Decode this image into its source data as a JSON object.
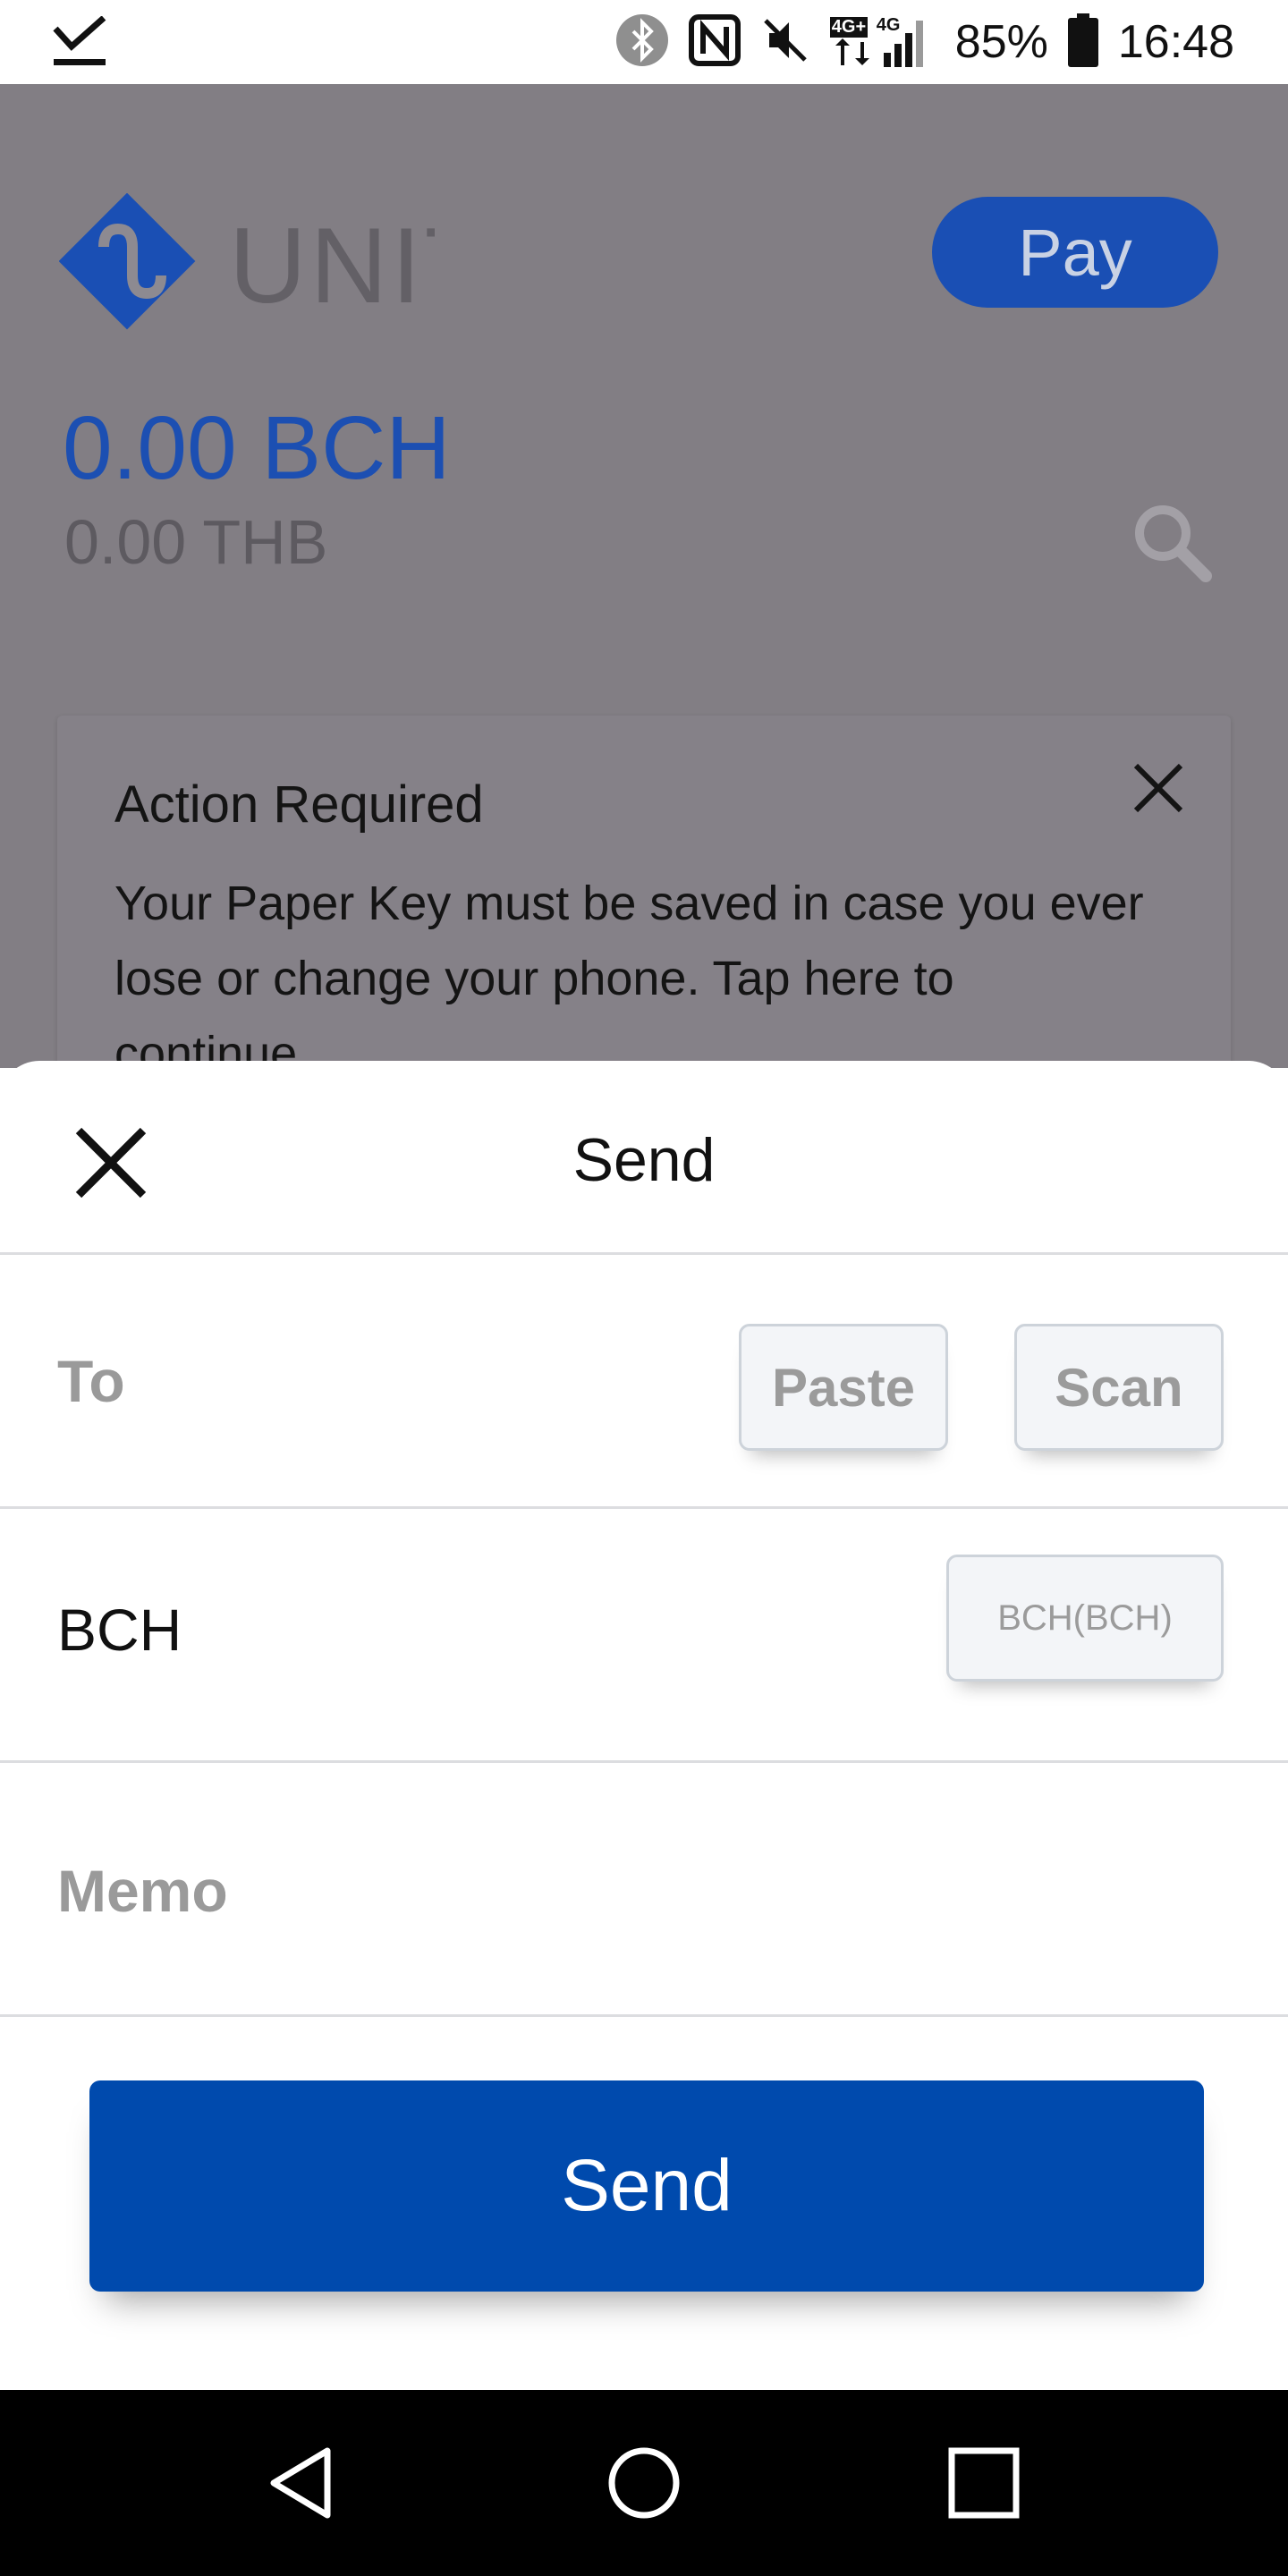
{
  "status_bar": {
    "battery_percent": "85%",
    "time": "16:48",
    "network_labels": [
      "4G+",
      "4G"
    ],
    "icons": [
      "download-done-icon",
      "bluetooth-icon",
      "nfc-icon",
      "mute-icon",
      "signal-icon",
      "battery-icon"
    ]
  },
  "background_app": {
    "logo_text": "UNIT",
    "pay_label": "Pay",
    "balance_crypto": "0.00 BCH",
    "balance_fiat": "0.00 THB",
    "action_card": {
      "title": "Action Required",
      "body": "Your Paper Key must be saved in case you ever lose or change your phone. Tap here to continue."
    }
  },
  "send_sheet": {
    "title": "Send",
    "to_label": "To",
    "paste_label": "Paste",
    "scan_label": "Scan",
    "amount_label": "BCH",
    "currency_selector": "BCH(BCH)",
    "memo_placeholder": "Memo",
    "send_button": "Send"
  },
  "colors": {
    "primary_blue": "#004aad",
    "overlay": "#827e84",
    "balance_blue": "#1c4fb2"
  }
}
